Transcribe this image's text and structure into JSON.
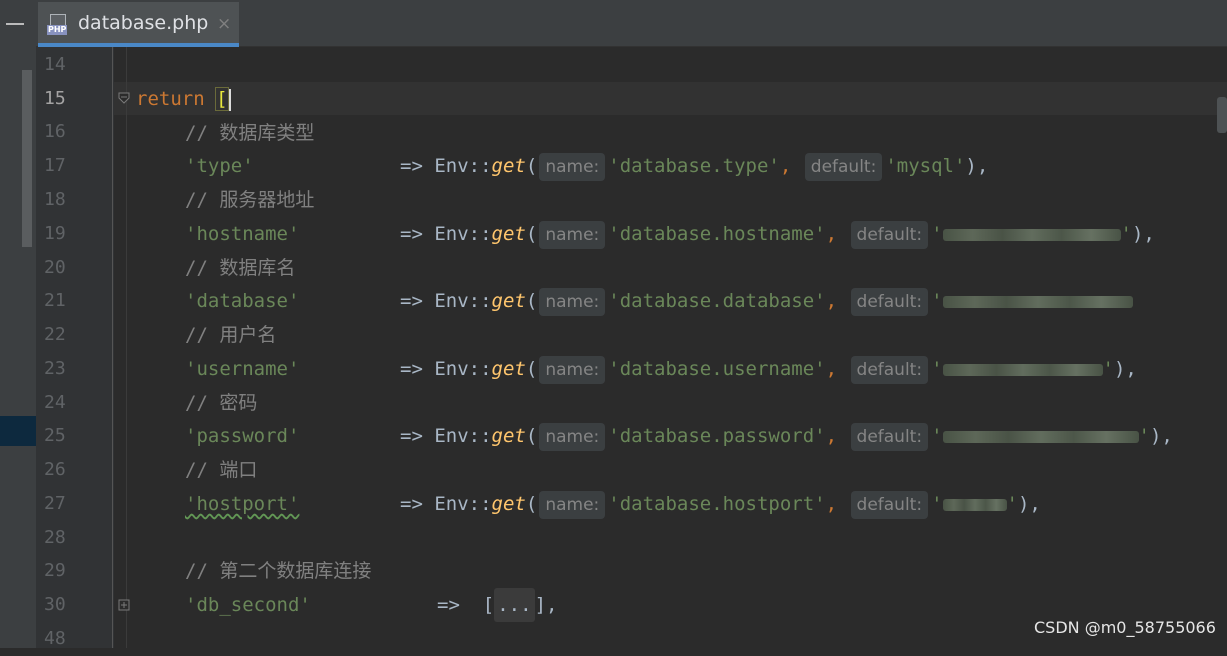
{
  "tab": {
    "title": "database.php",
    "close": "×",
    "icon_label": "PHP"
  },
  "line_numbers": [
    "14",
    "15",
    "16",
    "17",
    "18",
    "19",
    "20",
    "21",
    "22",
    "23",
    "24",
    "25",
    "26",
    "27",
    "28",
    "29",
    "30",
    "48"
  ],
  "code": {
    "l15": {
      "kw": "return",
      "bracket": "["
    },
    "l16": {
      "comment": "// 数据库类型"
    },
    "l17": {
      "key": "'type'",
      "arrow": "=>",
      "cls": "Env::",
      "fn": "get",
      "open": "(",
      "hint1": "name:",
      "arg1": "'database.type'",
      "comma": ",",
      "hint2": "default:",
      "arg2": "'mysql'",
      "close": "),"
    },
    "l18": {
      "comment": "// 服务器地址"
    },
    "l19": {
      "key": "'hostname'",
      "arrow": "=>",
      "cls": "Env::",
      "fn": "get",
      "open": "(",
      "hint1": "name:",
      "arg1": "'database.hostname'",
      "comma": ",",
      "hint2": "default:",
      "arg2_open": "'",
      "arg2_close": "'",
      "close": "),"
    },
    "l20": {
      "comment": "// 数据库名"
    },
    "l21": {
      "key": "'database'",
      "arrow": "=>",
      "cls": "Env::",
      "fn": "get",
      "open": "(",
      "hint1": "name:",
      "arg1": "'database.database'",
      "comma": ",",
      "hint2": "default:",
      "arg2_open": "'"
    },
    "l22": {
      "comment": "// 用户名"
    },
    "l23": {
      "key": "'username'",
      "arrow": "=>",
      "cls": "Env::",
      "fn": "get",
      "open": "(",
      "hint1": "name:",
      "arg1": "'database.username'",
      "comma": ",",
      "hint2": "default:",
      "arg2_open": "'",
      "arg2_close": "'",
      "close": "),"
    },
    "l24": {
      "comment": "// 密码"
    },
    "l25": {
      "key": "'password'",
      "arrow": "=>",
      "cls": "Env::",
      "fn": "get",
      "open": "(",
      "hint1": "name:",
      "arg1": "'database.password'",
      "comma": ",",
      "hint2": "default:",
      "arg2_open": "'",
      "arg2_close": "'",
      "close": "),"
    },
    "l26": {
      "comment": "// 端口"
    },
    "l27": {
      "key": "'hostport'",
      "arrow": "=>",
      "cls": "Env::",
      "fn": "get",
      "open": "(",
      "hint1": "name:",
      "arg1": "'database.hostport'",
      "comma": ",",
      "hint2": "default:",
      "arg2_open": "'",
      "arg2_close": "'",
      "close": "),"
    },
    "l29": {
      "comment": "// 第二个数据库连接"
    },
    "l30": {
      "key": "'db_second'",
      "arrow": "=>",
      "open": "[",
      "folded": "...",
      "close": "],"
    }
  },
  "watermark": "CSDN @m0_58755066",
  "colors": {
    "keyword": "#cc7832",
    "string": "#6a8759",
    "comment": "#808080",
    "function": "#ffc66d",
    "background": "#2b2b2b"
  }
}
